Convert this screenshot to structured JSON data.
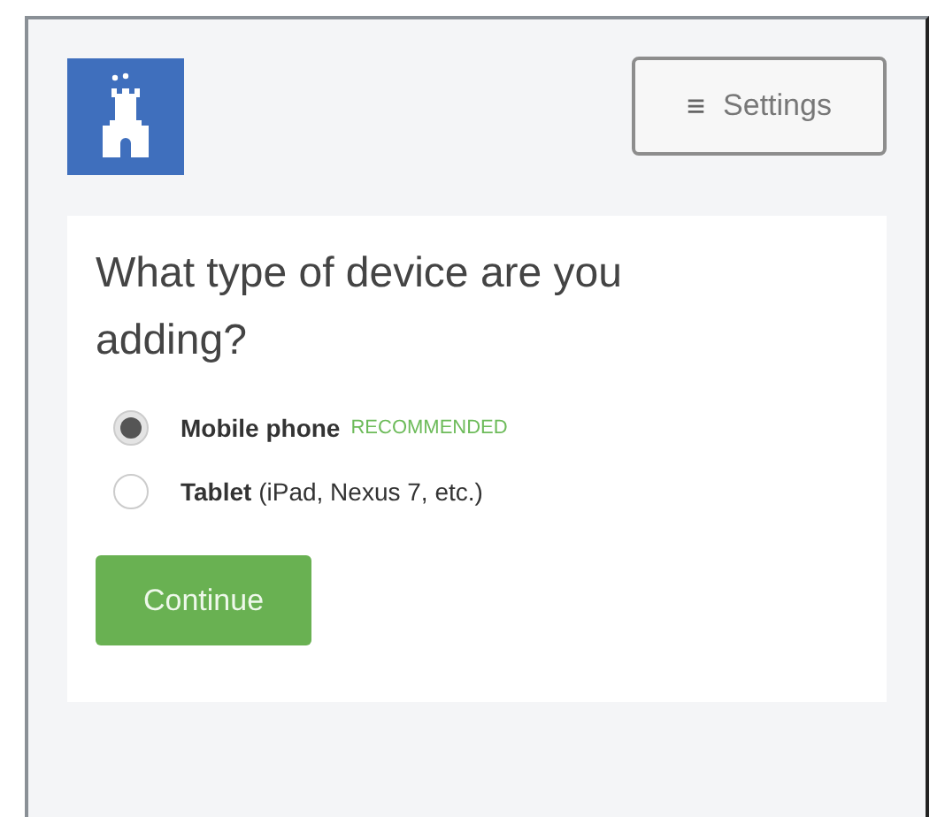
{
  "header": {
    "settings_button": {
      "icon": "≡",
      "label": "Settings"
    }
  },
  "question": {
    "title": "What type of device are you adding?",
    "options": [
      {
        "name": "Mobile phone",
        "badge": "RECOMMENDED",
        "selected": true
      },
      {
        "name": "Tablet",
        "detail": "(iPad, Nexus 7, etc.)",
        "selected": false
      }
    ],
    "continue_button": "Continue"
  }
}
